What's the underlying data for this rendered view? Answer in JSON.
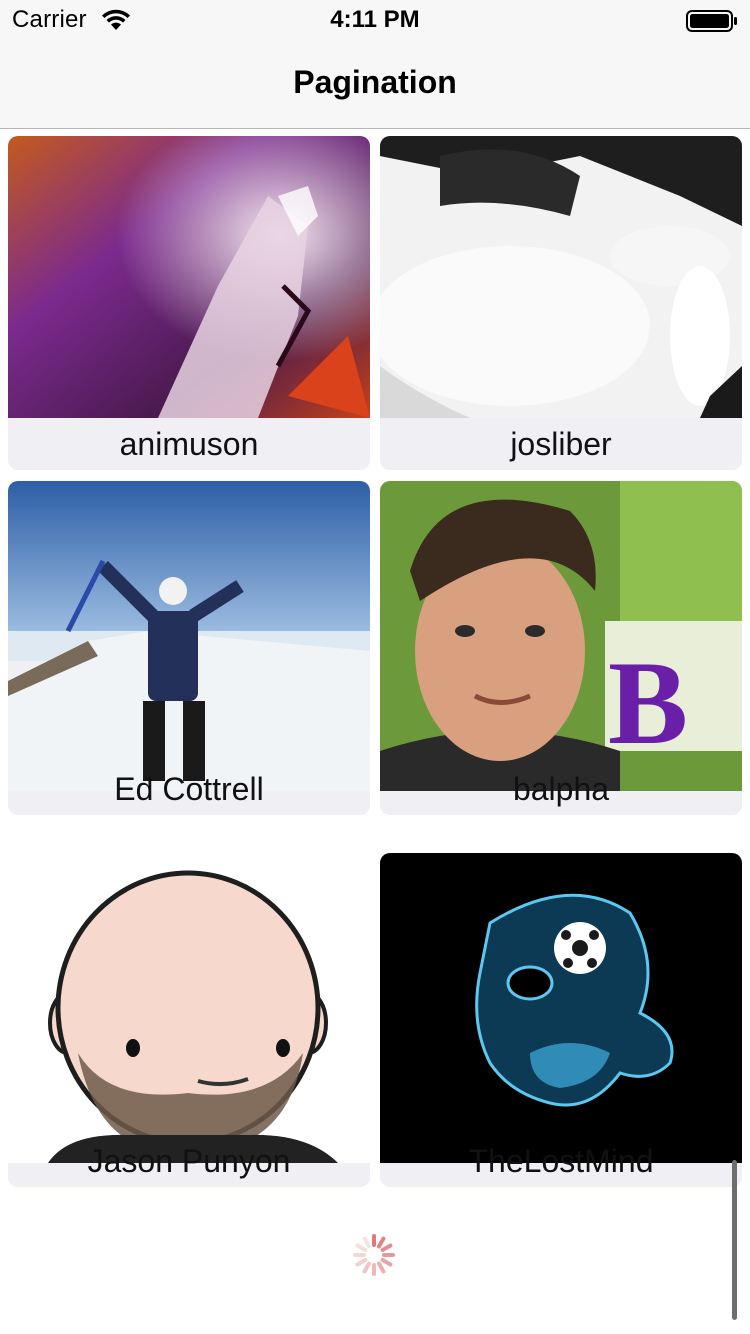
{
  "status_bar": {
    "carrier": "Carrier",
    "time": "4:11 PM",
    "wifi_icon": "wifi-icon",
    "battery_icon": "battery-icon"
  },
  "nav": {
    "title": "Pagination"
  },
  "users": [
    {
      "name": "animuson",
      "avatar_icon": "avatar-image"
    },
    {
      "name": "josliber",
      "avatar_icon": "avatar-image"
    },
    {
      "name": "Ed Cottrell",
      "avatar_icon": "avatar-image"
    },
    {
      "name": "balpha",
      "avatar_icon": "avatar-image"
    },
    {
      "name": "Jason Punyon",
      "avatar_icon": "avatar-image"
    },
    {
      "name": "TheLostMind",
      "avatar_icon": "avatar-image"
    }
  ],
  "loading": {
    "spinner_icon": "activity-spinner-icon"
  },
  "colors": {
    "bar_background": "#f7f7f7",
    "cell_background": "#efeff4",
    "spinner": "#e07a7a"
  }
}
